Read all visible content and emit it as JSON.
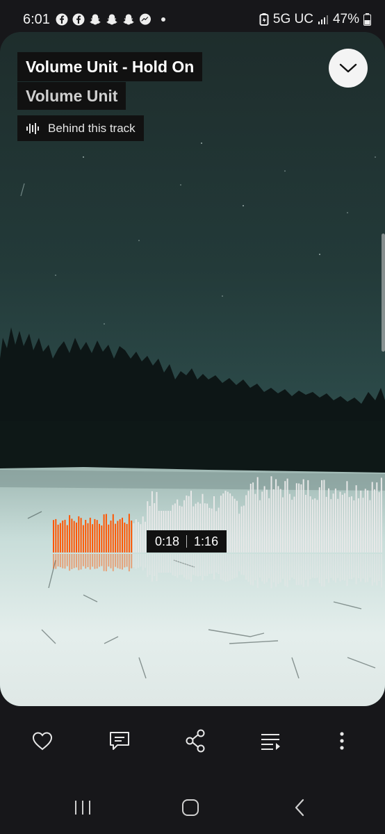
{
  "status_bar": {
    "time": "6:01",
    "notification_icons": [
      "facebook-icon",
      "facebook-icon",
      "snapchat-icon",
      "snapchat-icon",
      "snapchat-icon",
      "messenger-icon"
    ],
    "network": "5G UC",
    "battery": "47%"
  },
  "track": {
    "title": "Volume Unit - Hold On",
    "artist": "Volume Unit",
    "behind_label": "Behind this track"
  },
  "player": {
    "elapsed": "0:18",
    "duration": "1:16",
    "progress_fraction": 0.237,
    "played_color": "#ff5500",
    "unplayed_color": "#e8e8e8"
  },
  "actions": [
    "like-icon",
    "comment-icon",
    "share-icon",
    "queue-icon",
    "more-icon"
  ],
  "nav": [
    "recent-apps-icon",
    "home-icon",
    "back-icon"
  ]
}
